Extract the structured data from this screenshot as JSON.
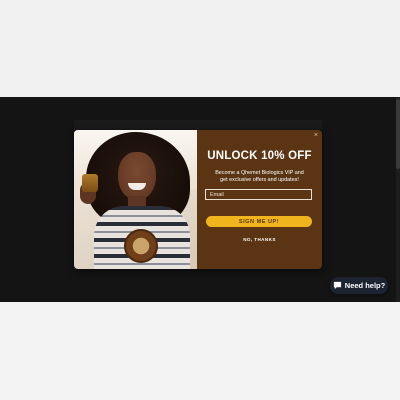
{
  "popup": {
    "headline": "UNLOCK 10% OFF",
    "subtext_line1": "Become a Qhemet Biologics VIP and",
    "subtext_line2": "get exclusive offers and updates!",
    "email_placeholder": "Email",
    "email_value": "",
    "cta_label": "SIGN ME UP!",
    "decline_label": "NO, THANKS",
    "close_symbol": "×",
    "colors": {
      "panel": "#5b3513",
      "cta": "#f0b51c",
      "overlay": "#141414"
    }
  },
  "chat": {
    "label": "Need help?",
    "icon": "chat-bubble-icon"
  }
}
